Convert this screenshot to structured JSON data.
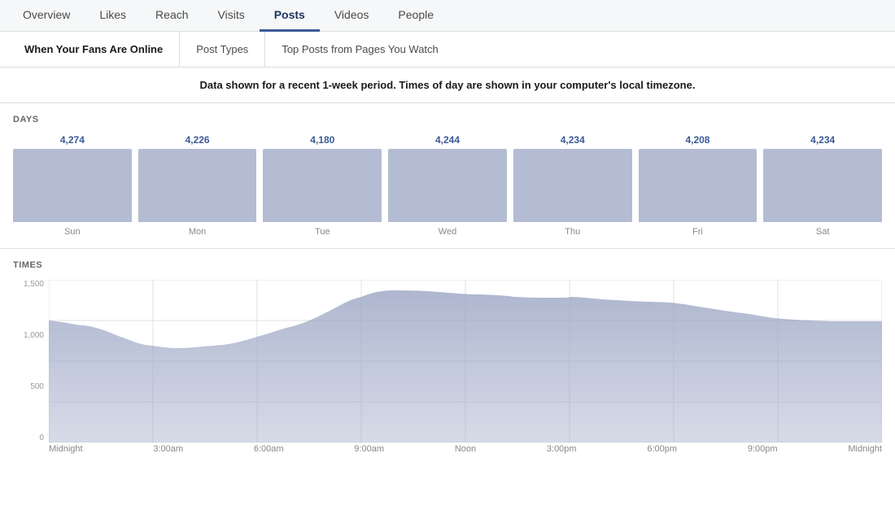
{
  "topNav": {
    "items": [
      {
        "label": "Overview",
        "active": false
      },
      {
        "label": "Likes",
        "active": false
      },
      {
        "label": "Reach",
        "active": false
      },
      {
        "label": "Visits",
        "active": false
      },
      {
        "label": "Posts",
        "active": true
      },
      {
        "label": "Videos",
        "active": false
      },
      {
        "label": "People",
        "active": false
      }
    ]
  },
  "subNav": {
    "items": [
      {
        "label": "When Your Fans Are Online"
      },
      {
        "label": "Post Types"
      },
      {
        "label": "Top Posts from Pages You Watch"
      }
    ]
  },
  "infoBar": {
    "text": "Data shown for a recent 1-week period. Times of day are shown in your computer's local timezone."
  },
  "daysSection": {
    "label": "DAYS",
    "days": [
      {
        "name": "Sun",
        "value": "4,274"
      },
      {
        "name": "Mon",
        "value": "4,226"
      },
      {
        "name": "Tue",
        "value": "4,180"
      },
      {
        "name": "Wed",
        "value": "4,244"
      },
      {
        "name": "Thu",
        "value": "4,234"
      },
      {
        "name": "Fri",
        "value": "4,208"
      },
      {
        "name": "Sat",
        "value": "4,234"
      }
    ]
  },
  "timesSection": {
    "label": "TIMES",
    "yLabels": [
      "1,500",
      "1,000",
      "500",
      "0"
    ],
    "xLabels": [
      "Midnight",
      "3:00am",
      "6:00am",
      "9:00am",
      "Noon",
      "3:00pm",
      "6:00pm",
      "9:00pm",
      "Midnight"
    ],
    "chartColor": "#9aa5c4",
    "chartOpacity": "0.65"
  }
}
